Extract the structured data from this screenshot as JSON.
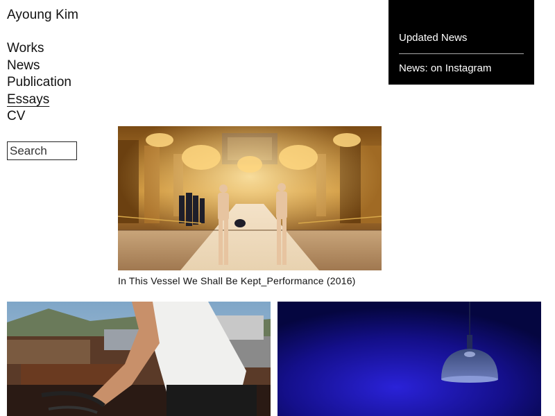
{
  "site": {
    "title": "Ayoung Kim"
  },
  "nav": {
    "items": [
      {
        "label": "Works",
        "active": false
      },
      {
        "label": "News",
        "active": false
      },
      {
        "label": "Publication",
        "active": false
      },
      {
        "label": "Essays",
        "active": true
      },
      {
        "label": "CV",
        "active": false
      }
    ]
  },
  "search": {
    "placeholder": "Search"
  },
  "news_box": {
    "items": [
      {
        "label": "Updated News"
      },
      {
        "label": "News: on Instagram"
      }
    ]
  },
  "feature": {
    "caption": "In This Vessel We Shall Be Kept_Performance (2016)"
  }
}
